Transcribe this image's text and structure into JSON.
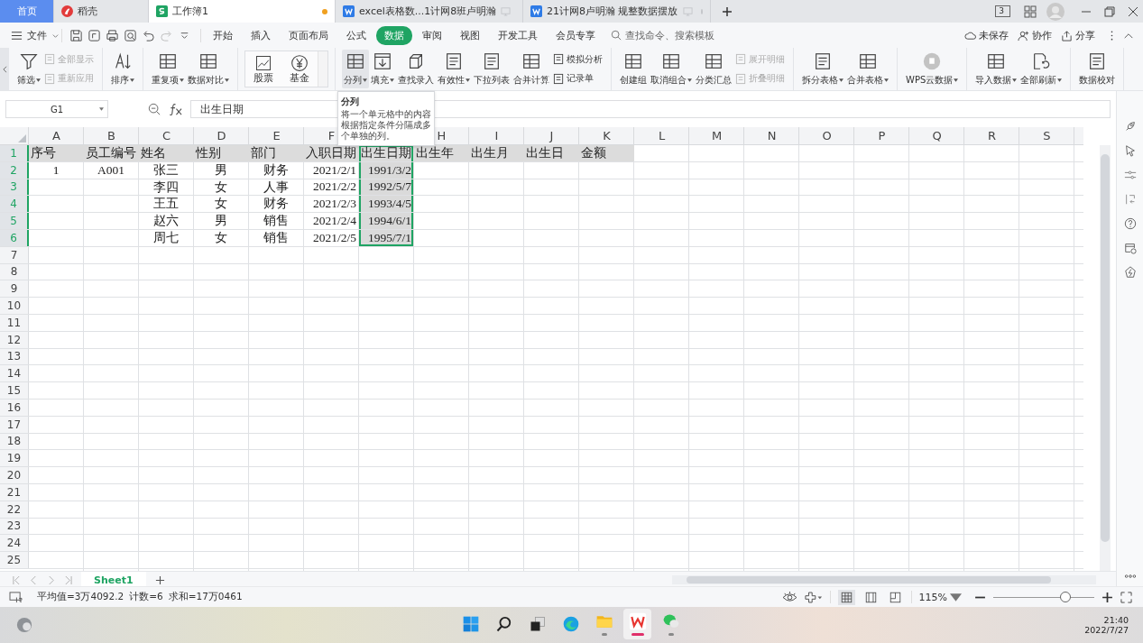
{
  "title_tabs": [
    {
      "label": "首页",
      "kind": "home",
      "selected": false,
      "unsaved": false
    },
    {
      "label": "稻壳",
      "kind": "app",
      "selected": false,
      "unsaved": false
    },
    {
      "label": "工作簿1",
      "kind": "sheet",
      "selected": true,
      "unsaved": true
    },
    {
      "label": "excel表格数...1计网8班卢明瀚",
      "kind": "doc",
      "selected": false,
      "unsaved": false
    },
    {
      "label": "21计网8卢明瀚 规整数据摆放",
      "kind": "doc",
      "selected": false,
      "unsaved": false
    }
  ],
  "window_count": "3",
  "file_menu": "文件",
  "menu_tabs": [
    {
      "label": "开始",
      "selected": false
    },
    {
      "label": "插入",
      "selected": false
    },
    {
      "label": "页面布局",
      "selected": false
    },
    {
      "label": "公式",
      "selected": false
    },
    {
      "label": "数据",
      "selected": true
    },
    {
      "label": "审阅",
      "selected": false
    },
    {
      "label": "视图",
      "selected": false
    },
    {
      "label": "开发工具",
      "selected": false
    },
    {
      "label": "会员专享",
      "selected": false
    }
  ],
  "search": {
    "placeholder": "查找命令、搜索模板"
  },
  "actions": [
    "未保存",
    "协作",
    "分享"
  ],
  "ribbon": [
    {
      "items": [
        {
          "kind": "large",
          "label": "筛选",
          "dropdown": true,
          "highlighted": false
        },
        {
          "kind": "stack",
          "items": [
            {
              "label": "全部显示",
              "disabled": true
            },
            {
              "label": "重新应用",
              "disabled": true
            }
          ]
        }
      ]
    },
    {
      "items": [
        {
          "kind": "large",
          "label": "排序",
          "dropdown": true,
          "highlighted": false
        }
      ]
    },
    {
      "items": [
        {
          "kind": "large",
          "label": "重复项",
          "dropdown": true,
          "highlighted": false
        },
        {
          "kind": "large",
          "label": "数据对比",
          "dropdown": true,
          "highlighted": false
        }
      ]
    },
    {
      "items": [
        {
          "kind": "gallery",
          "items": [
            "股票",
            "基金"
          ]
        }
      ]
    },
    {
      "items": [
        {
          "kind": "large",
          "label": "分列",
          "dropdown": true,
          "highlighted": true
        },
        {
          "kind": "large",
          "label": "填充",
          "dropdown": true,
          "highlighted": false
        },
        {
          "kind": "large",
          "label": "查找录入",
          "dropdown": false,
          "highlighted": false
        },
        {
          "kind": "large",
          "label": "有效性",
          "dropdown": true,
          "highlighted": false
        },
        {
          "kind": "large",
          "label": "下拉列表",
          "dropdown": false,
          "highlighted": false
        },
        {
          "kind": "large",
          "label": "合并计算",
          "dropdown": false,
          "highlighted": false
        },
        {
          "kind": "stack",
          "items": [
            {
              "label": "模拟分析",
              "disabled": false
            },
            {
              "label": "记录单",
              "disabled": false
            }
          ]
        }
      ]
    },
    {
      "items": [
        {
          "kind": "large",
          "label": "创建组",
          "dropdown": false,
          "highlighted": false
        },
        {
          "kind": "large",
          "label": "取消组合",
          "dropdown": true,
          "highlighted": false
        },
        {
          "kind": "large",
          "label": "分类汇总",
          "dropdown": false,
          "highlighted": false
        },
        {
          "kind": "stack",
          "items": [
            {
              "label": "展开明细",
              "disabled": true
            },
            {
              "label": "折叠明细",
              "disabled": true
            }
          ]
        }
      ]
    },
    {
      "items": [
        {
          "kind": "large",
          "label": "拆分表格",
          "dropdown": true,
          "highlighted": false
        },
        {
          "kind": "large",
          "label": "合并表格",
          "dropdown": true,
          "highlighted": false
        }
      ]
    },
    {
      "items": [
        {
          "kind": "large",
          "label": "WPS云数据",
          "dropdown": true,
          "highlighted": false
        }
      ]
    },
    {
      "items": [
        {
          "kind": "large",
          "label": "导入数据",
          "dropdown": true,
          "highlighted": false
        },
        {
          "kind": "large",
          "label": "全部刷新",
          "dropdown": true,
          "highlighted": false
        }
      ]
    },
    {
      "items": [
        {
          "kind": "large",
          "label": "数据校对",
          "dropdown": false,
          "highlighted": false
        }
      ]
    }
  ],
  "name_box": "G1",
  "formula": "出生日期",
  "tooltip": {
    "title": "分列",
    "text": "将一个单元格中的内容根据指定条件分隔成多个单独的列。"
  },
  "columns": [
    {
      "letter": "A",
      "selected": false
    },
    {
      "letter": "B",
      "selected": false
    },
    {
      "letter": "C",
      "selected": false
    },
    {
      "letter": "D",
      "selected": false
    },
    {
      "letter": "E",
      "selected": false
    },
    {
      "letter": "F",
      "selected": false
    },
    {
      "selected": true
    },
    {
      "letter": "H",
      "selected": false
    },
    {
      "letter": "I",
      "selected": false
    },
    {
      "letter": "J",
      "selected": false
    },
    {
      "letter": "K",
      "selected": false
    },
    {
      "letter": "L",
      "selected": false
    },
    {
      "letter": "M",
      "selected": false
    },
    {
      "letter": "N",
      "selected": false
    },
    {
      "letter": "O",
      "selected": false
    },
    {
      "letter": "P",
      "selected": false
    },
    {
      "letter": "Q",
      "selected": false
    },
    {
      "letter": "R",
      "selected": false
    },
    {
      "letter": "S",
      "selected": false
    }
  ],
  "rows": [
    {
      "header": "1",
      "selected": true,
      "shaded": true,
      "cells": [
        "序号",
        "员工编号",
        "姓名",
        "性别",
        "部门",
        "入职日期",
        "出生日期",
        "出生年",
        "出生月",
        "出生日",
        "金额"
      ]
    },
    {
      "header": "2",
      "selected": true,
      "shaded": false,
      "cells": [
        "1",
        "A001",
        "张三",
        "男",
        "财务",
        "2021/2/1",
        "1991/3/2"
      ]
    },
    {
      "header": "3",
      "selected": true,
      "shaded": false,
      "cells": [
        null,
        null,
        "李四",
        "女",
        "人事",
        "2021/2/2",
        "1992/5/7"
      ]
    },
    {
      "header": "4",
      "selected": true,
      "shaded": false,
      "cells": [
        null,
        null,
        "王五",
        "女",
        "财务",
        "2021/2/3",
        "1993/4/5"
      ]
    },
    {
      "header": "5",
      "selected": true,
      "shaded": false,
      "cells": [
        null,
        null,
        "赵六",
        "男",
        "销售",
        "2021/2/4",
        "1994/6/1"
      ]
    },
    {
      "header": "6",
      "selected": true,
      "shaded": false,
      "cells": [
        null,
        null,
        "周七",
        "女",
        "销售",
        "2021/2/5",
        "1995/7/1"
      ]
    },
    {
      "header": "7",
      "selected": false
    },
    {
      "header": "8",
      "selected": false
    },
    {
      "header": "9",
      "selected": false
    },
    {
      "header": "10",
      "selected": false
    },
    {
      "header": "11",
      "selected": false
    },
    {
      "header": "12",
      "selected": false
    },
    {
      "header": "13",
      "selected": false
    },
    {
      "header": "14",
      "selected": false
    },
    {
      "header": "15",
      "selected": false
    },
    {
      "header": "16",
      "selected": false
    },
    {
      "header": "17",
      "selected": false
    },
    {
      "header": "18",
      "selected": false
    },
    {
      "header": "19",
      "selected": false
    },
    {
      "header": "20",
      "selected": false
    },
    {
      "header": "21",
      "selected": false
    },
    {
      "header": "22",
      "selected": false
    },
    {
      "header": "23",
      "selected": false
    },
    {
      "header": "24",
      "selected": false
    },
    {
      "header": "25",
      "selected": false
    }
  ],
  "sheets": [
    {
      "label": "Sheet1",
      "selected": true
    }
  ],
  "status": [
    "平均值=3万4092.2",
    "计数=6",
    "求和=17万0461"
  ],
  "view_modes": [
    {
      "selected": true
    },
    {
      "selected": false
    },
    {
      "selected": false
    }
  ],
  "zoom": {
    "text": "115%",
    "level": 0.71
  },
  "taskbar": [
    {
      "kind": "start",
      "open": false,
      "selected": false
    },
    {
      "kind": "search",
      "open": false,
      "selected": false
    },
    {
      "kind": "taskview",
      "open": false,
      "selected": false
    },
    {
      "kind": "edge",
      "open": false,
      "selected": false
    },
    {
      "kind": "folder",
      "open": true,
      "selected": false
    },
    {
      "kind": "wps",
      "open": true,
      "selected": true
    },
    {
      "kind": "chat",
      "open": true,
      "selected": false
    }
  ],
  "clock": {
    "time": "21:40",
    "date": "2022/7/27"
  }
}
